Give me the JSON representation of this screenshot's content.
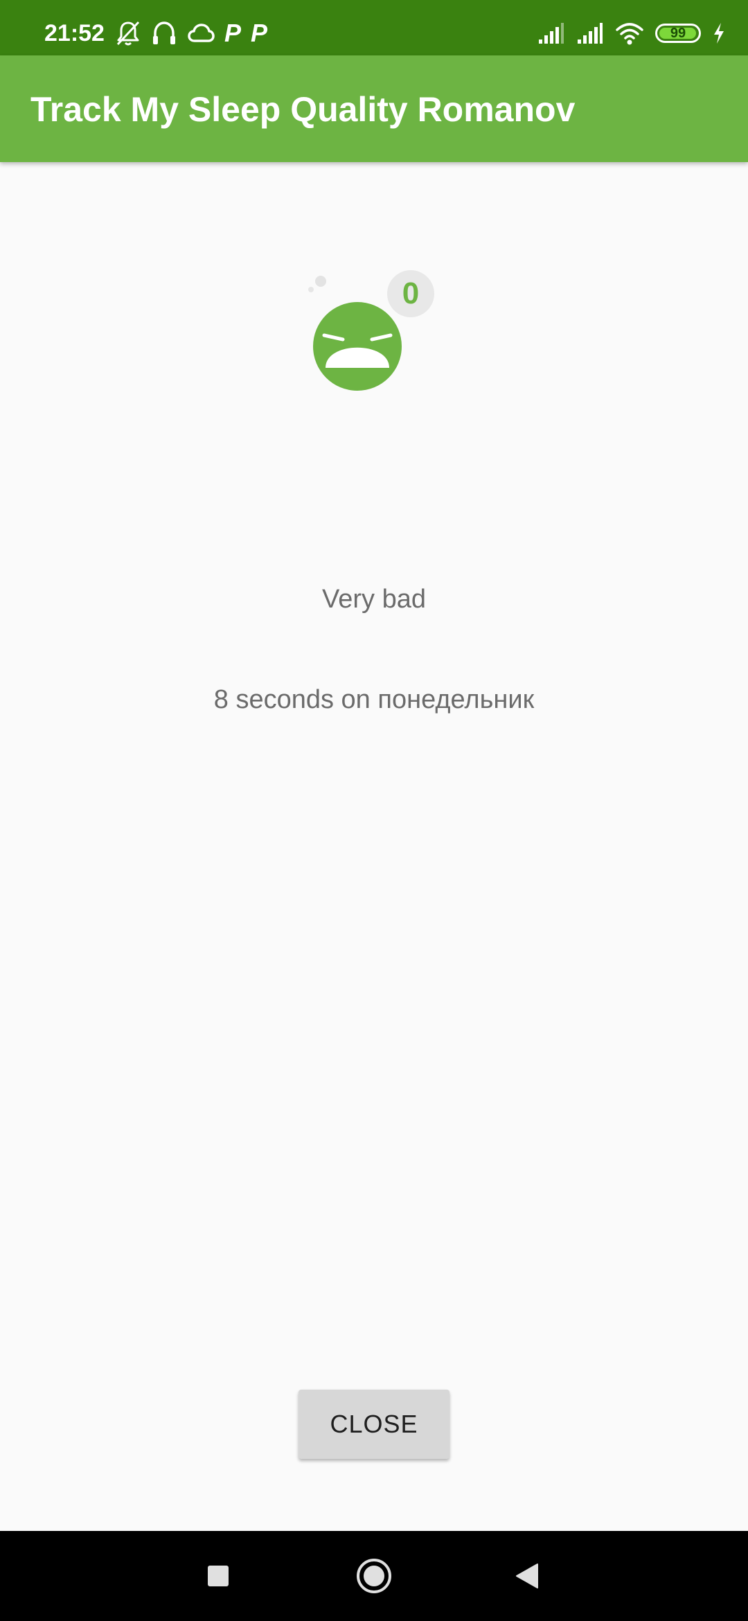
{
  "status_bar": {
    "time": "21:52",
    "battery": "99",
    "battery_level": 0.99,
    "left_icons": [
      "bell-off-icon",
      "headphones-icon",
      "cloud-icon",
      "parking-icon",
      "parking-icon"
    ],
    "right_icons": [
      "signal-icon",
      "signal-icon",
      "wifi-icon",
      "battery-icon",
      "charging-icon"
    ],
    "parking_glyph": "P"
  },
  "app_bar": {
    "title": "Track My Sleep Quality Romanov"
  },
  "quality": {
    "icon": "sleep-quality-very-bad-icon",
    "score": "0",
    "label": "Very bad"
  },
  "duration": {
    "text": "8 seconds on понедельник"
  },
  "actions": {
    "close_label": "CLOSE"
  },
  "nav_bar": {
    "items": [
      "recents-button",
      "home-button",
      "back-button"
    ]
  },
  "colors": {
    "status_bar": "#3a8210",
    "app_bar": "#6db443",
    "face": "#6db443",
    "background": "#fafafa",
    "text_secondary": "#6b6b6b",
    "button": "#d7d7d7"
  }
}
